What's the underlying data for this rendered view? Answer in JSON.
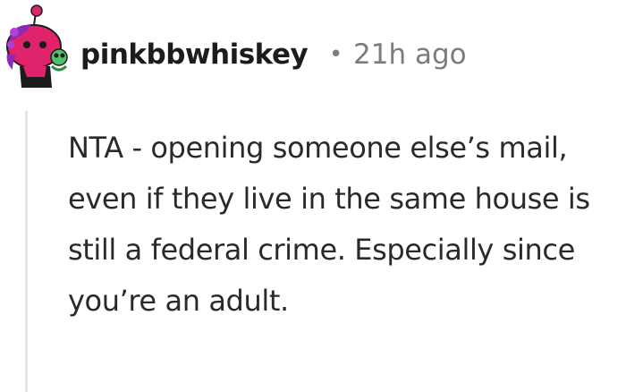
{
  "comment": {
    "username": "pinkbbwhiskey",
    "separator": "•",
    "timestamp": "21h ago",
    "avatar_icon": "snoo-avatar-icon",
    "body": "NTA - opening someone else’s mail, even if they live in the same house is still a federal crime. Especially since you’re an adult."
  },
  "colors": {
    "username": "#1c1c1c",
    "timestamp": "#7c7c7c",
    "body_text": "#2a2a2a",
    "thread_line": "#e5e5e5",
    "avatar_primary": "#e0246c"
  }
}
